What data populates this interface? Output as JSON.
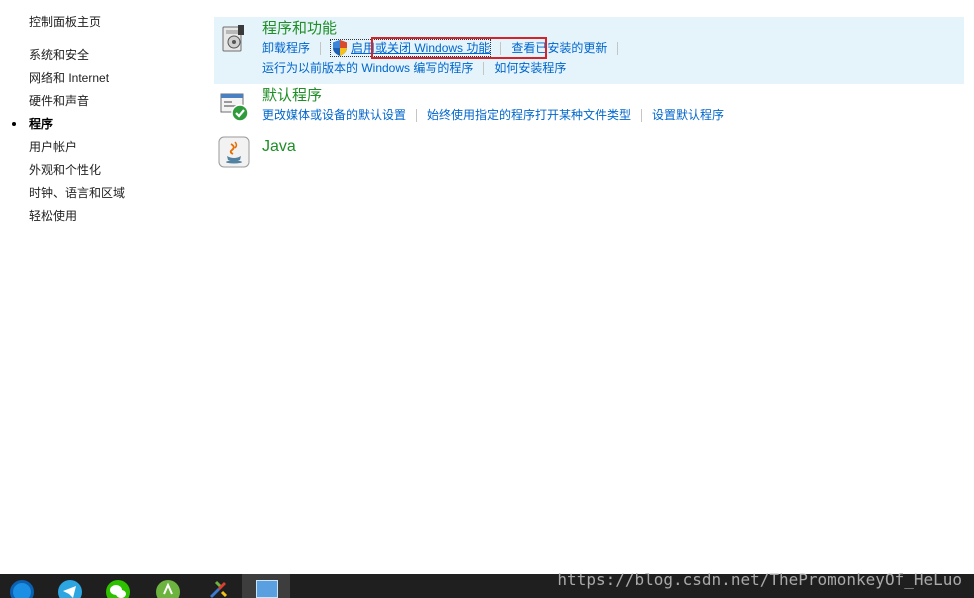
{
  "left_nav": {
    "items": [
      {
        "label": "控制面板主页",
        "active": false
      },
      {
        "label": "系统和安全",
        "active": false
      },
      {
        "label": "网络和 Internet",
        "active": false
      },
      {
        "label": "硬件和声音",
        "active": false
      },
      {
        "label": "程序",
        "active": true
      },
      {
        "label": "用户帐户",
        "active": false
      },
      {
        "label": "外观和个性化",
        "active": false
      },
      {
        "label": "时钟、语言和区域",
        "active": false
      },
      {
        "label": "轻松使用",
        "active": false
      }
    ]
  },
  "sections": [
    {
      "title": "程序和功能",
      "icon": "programs-features-icon",
      "links_row1": [
        "卸载程序",
        "启用或关闭 Windows 功能",
        "查看已安装的更新"
      ],
      "links_row2": [
        "运行为以前版本的 Windows 编写的程序",
        "如何安装程序"
      ]
    },
    {
      "title": "默认程序",
      "icon": "default-programs-icon",
      "links_row1": [
        "更改媒体或设备的默认设置",
        "始终使用指定的程序打开某种文件类型",
        "设置默认程序"
      ]
    },
    {
      "title": "Java",
      "icon": "java-icon"
    }
  ],
  "taskbar": {
    "icons": [
      "browser-icon",
      "telegram-icon",
      "wechat-icon",
      "android-studio-icon",
      "tool-icon",
      "control-panel-icon"
    ],
    "active_index": 5
  },
  "watermark": "https://blog.csdn.net/ThePromonkeyOf_HeLuo",
  "colors": {
    "link": "#0066cc",
    "section_title": "#1e8e26",
    "highlight_bg": "#e5f3fb",
    "red_box": "#d8222a",
    "taskbar_bg": "#1f1f1f"
  }
}
